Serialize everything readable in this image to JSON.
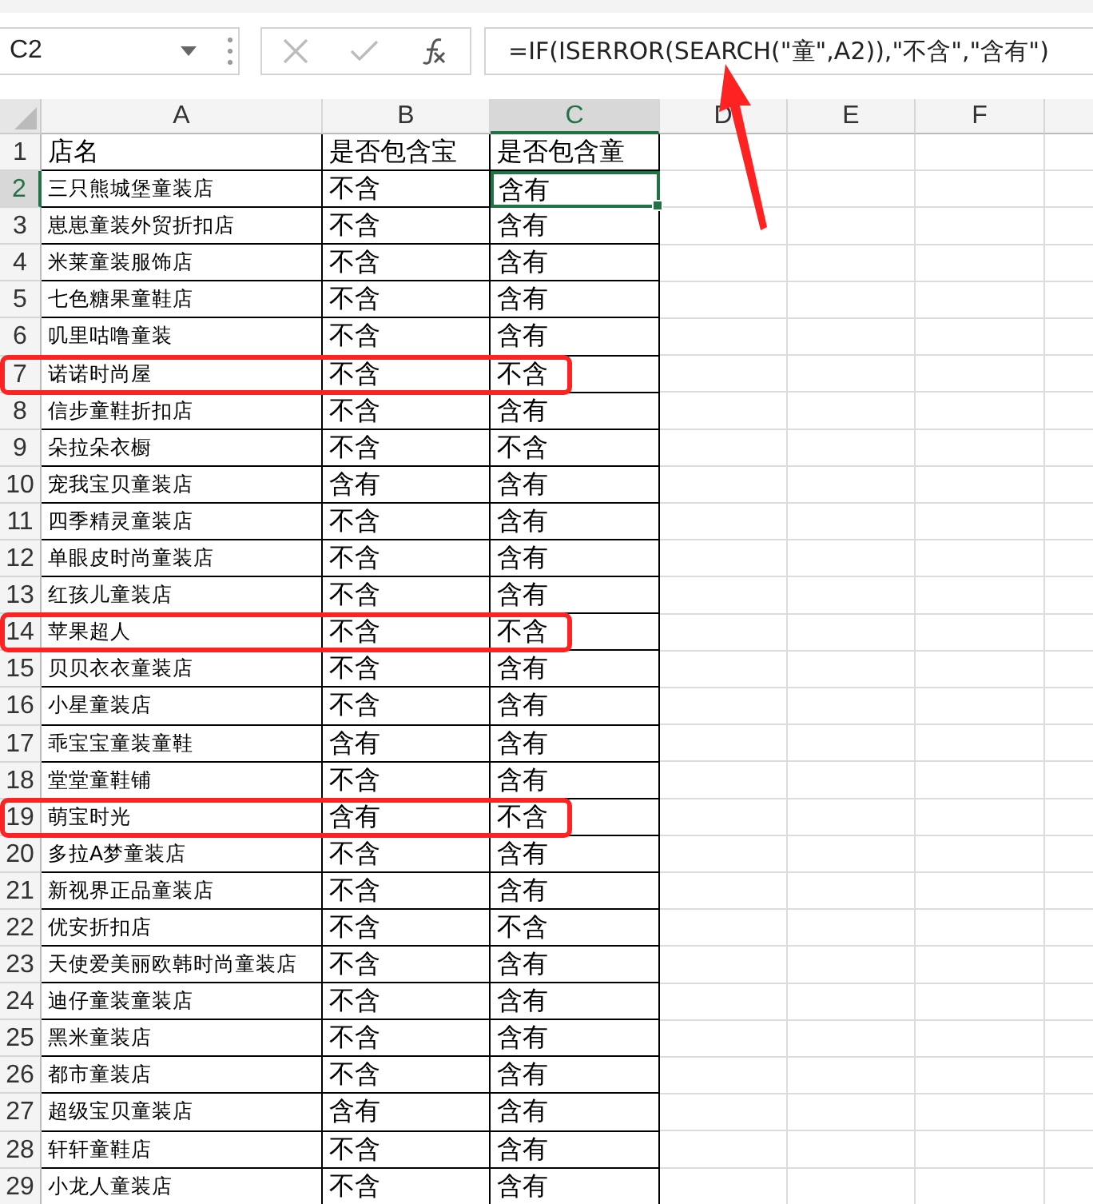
{
  "name_box": "C2",
  "formula": "=IF(ISERROR(SEARCH(\"童\",A2)),\"不含\",\"含有\")",
  "columns": [
    {
      "label": "A",
      "selected": false
    },
    {
      "label": "B",
      "selected": false
    },
    {
      "label": "C",
      "selected": true
    },
    {
      "label": "D",
      "selected": false
    },
    {
      "label": "E",
      "selected": false
    },
    {
      "label": "F",
      "selected": false
    }
  ],
  "rows": [
    {
      "number": "1",
      "cells": [
        "店名",
        "是否包含宝",
        "是否包含童"
      ],
      "selected": false,
      "highlighted": false
    },
    {
      "number": "2",
      "cells": [
        "三只熊城堡童装店",
        "不含",
        "含有"
      ],
      "selected": true,
      "highlighted": false
    },
    {
      "number": "3",
      "cells": [
        "崽崽童装外贸折扣店",
        "不含",
        "含有"
      ],
      "selected": false,
      "highlighted": false
    },
    {
      "number": "4",
      "cells": [
        "米莱童装服饰店",
        "不含",
        "含有"
      ],
      "selected": false,
      "highlighted": false
    },
    {
      "number": "5",
      "cells": [
        "七色糖果童鞋店",
        "不含",
        "含有"
      ],
      "selected": false,
      "highlighted": false
    },
    {
      "number": "6",
      "cells": [
        "叽里咕噜童装",
        "不含",
        "含有"
      ],
      "selected": false,
      "highlighted": false
    },
    {
      "number": "7",
      "cells": [
        "诺诺时尚屋",
        "不含",
        "不含"
      ],
      "selected": false,
      "highlighted": true
    },
    {
      "number": "8",
      "cells": [
        "信步童鞋折扣店",
        "不含",
        "含有"
      ],
      "selected": false,
      "highlighted": false
    },
    {
      "number": "9",
      "cells": [
        "朵拉朵衣橱",
        "不含",
        "不含"
      ],
      "selected": false,
      "highlighted": false
    },
    {
      "number": "10",
      "cells": [
        "宠我宝贝童装店",
        "含有",
        "含有"
      ],
      "selected": false,
      "highlighted": false
    },
    {
      "number": "11",
      "cells": [
        "四季精灵童装店",
        "不含",
        "含有"
      ],
      "selected": false,
      "highlighted": false
    },
    {
      "number": "12",
      "cells": [
        "单眼皮时尚童装店",
        "不含",
        "含有"
      ],
      "selected": false,
      "highlighted": false
    },
    {
      "number": "13",
      "cells": [
        "红孩儿童装店",
        "不含",
        "含有"
      ],
      "selected": false,
      "highlighted": false
    },
    {
      "number": "14",
      "cells": [
        "苹果超人",
        "不含",
        "不含"
      ],
      "selected": false,
      "highlighted": true
    },
    {
      "number": "15",
      "cells": [
        "贝贝衣衣童装店",
        "不含",
        "含有"
      ],
      "selected": false,
      "highlighted": false
    },
    {
      "number": "16",
      "cells": [
        "小星童装店",
        "不含",
        "含有"
      ],
      "selected": false,
      "highlighted": false
    },
    {
      "number": "17",
      "cells": [
        "乖宝宝童装童鞋",
        "含有",
        "含有"
      ],
      "selected": false,
      "highlighted": false
    },
    {
      "number": "18",
      "cells": [
        "堂堂童鞋铺",
        "不含",
        "含有"
      ],
      "selected": false,
      "highlighted": false
    },
    {
      "number": "19",
      "cells": [
        "萌宝时光",
        "含有",
        "不含"
      ],
      "selected": false,
      "highlighted": true
    },
    {
      "number": "20",
      "cells": [
        "多拉A梦童装店",
        "不含",
        "含有"
      ],
      "selected": false,
      "highlighted": false
    },
    {
      "number": "21",
      "cells": [
        "新视界正品童装店",
        "不含",
        "含有"
      ],
      "selected": false,
      "highlighted": false
    },
    {
      "number": "22",
      "cells": [
        "优安折扣店",
        "不含",
        "不含"
      ],
      "selected": false,
      "highlighted": false
    },
    {
      "number": "23",
      "cells": [
        "天使爱美丽欧韩时尚童装店",
        "不含",
        "含有"
      ],
      "selected": false,
      "highlighted": false
    },
    {
      "number": "24",
      "cells": [
        "迪仔童装童装店",
        "不含",
        "含有"
      ],
      "selected": false,
      "highlighted": false
    },
    {
      "number": "25",
      "cells": [
        "黑米童装店",
        "不含",
        "含有"
      ],
      "selected": false,
      "highlighted": false
    },
    {
      "number": "26",
      "cells": [
        "都市童装店",
        "不含",
        "含有"
      ],
      "selected": false,
      "highlighted": false
    },
    {
      "number": "27",
      "cells": [
        "超级宝贝童装店",
        "含有",
        "含有"
      ],
      "selected": false,
      "highlighted": false
    },
    {
      "number": "28",
      "cells": [
        "轩轩童鞋店",
        "不含",
        "含有"
      ],
      "selected": false,
      "highlighted": false
    },
    {
      "number": "29",
      "cells": [
        "小龙人童装店",
        "不含",
        "含有"
      ],
      "selected": false,
      "highlighted": false
    }
  ]
}
